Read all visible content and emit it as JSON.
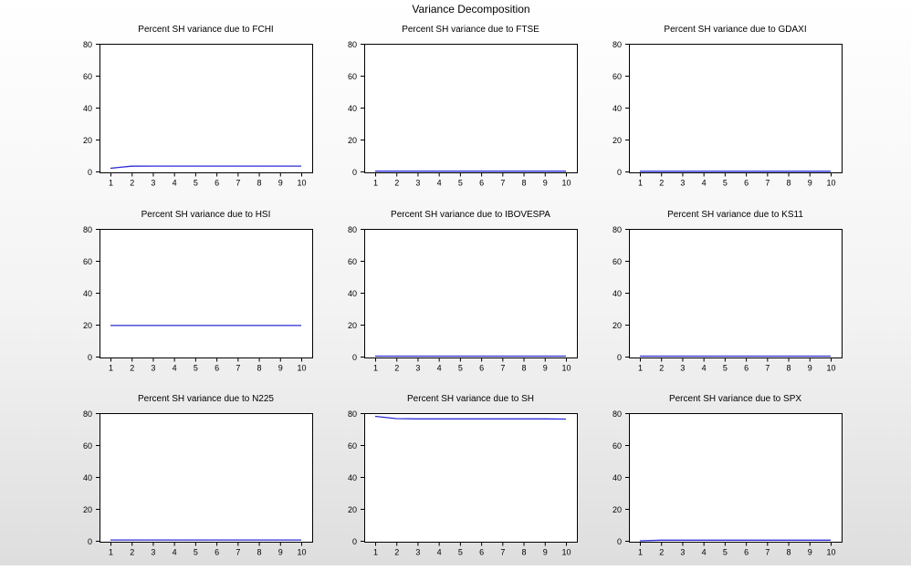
{
  "page": {
    "title": "Variance Decomposition"
  },
  "colors": {
    "line": "#2b2bd8",
    "axis": "#000000",
    "plot_bg": "#ffffff"
  },
  "chart_data": [
    {
      "type": "line",
      "title": "Percent SH variance due to FCHI",
      "x": [
        1,
        2,
        3,
        4,
        5,
        6,
        7,
        8,
        9,
        10
      ],
      "x_ticks": [
        "1",
        "2",
        "3",
        "4",
        "5",
        "6",
        "7",
        "8",
        "9",
        "10"
      ],
      "ylim": [
        0,
        80
      ],
      "y_ticks": [
        "0",
        "20",
        "40",
        "60",
        "80"
      ],
      "grid": false,
      "series": [
        {
          "values": [
            2.0,
            3.3,
            3.4,
            3.4,
            3.4,
            3.4,
            3.4,
            3.4,
            3.4,
            3.4
          ]
        }
      ]
    },
    {
      "type": "line",
      "title": "Percent SH variance due to FTSE",
      "x": [
        1,
        2,
        3,
        4,
        5,
        6,
        7,
        8,
        9,
        10
      ],
      "x_ticks": [
        "1",
        "2",
        "3",
        "4",
        "5",
        "6",
        "7",
        "8",
        "9",
        "10"
      ],
      "ylim": [
        0,
        80
      ],
      "y_ticks": [
        "0",
        "20",
        "40",
        "60",
        "80"
      ],
      "grid": false,
      "series": [
        {
          "values": [
            0.2,
            0.2,
            0.2,
            0.2,
            0.2,
            0.2,
            0.2,
            0.2,
            0.2,
            0.2
          ]
        }
      ]
    },
    {
      "type": "line",
      "title": "Percent SH variance due to GDAXI",
      "x": [
        1,
        2,
        3,
        4,
        5,
        6,
        7,
        8,
        9,
        10
      ],
      "x_ticks": [
        "1",
        "2",
        "3",
        "4",
        "5",
        "6",
        "7",
        "8",
        "9",
        "10"
      ],
      "ylim": [
        0,
        80
      ],
      "y_ticks": [
        "0",
        "20",
        "40",
        "60",
        "80"
      ],
      "grid": false,
      "series": [
        {
          "values": [
            0.1,
            0.1,
            0.1,
            0.1,
            0.1,
            0.1,
            0.1,
            0.1,
            0.1,
            0.1
          ]
        }
      ]
    },
    {
      "type": "line",
      "title": "Percent SH variance due to HSI",
      "x": [
        1,
        2,
        3,
        4,
        5,
        6,
        7,
        8,
        9,
        10
      ],
      "x_ticks": [
        "1",
        "2",
        "3",
        "4",
        "5",
        "6",
        "7",
        "8",
        "9",
        "10"
      ],
      "ylim": [
        0,
        80
      ],
      "y_ticks": [
        "0",
        "20",
        "40",
        "60",
        "80"
      ],
      "grid": false,
      "series": [
        {
          "values": [
            19.5,
            19.5,
            19.5,
            19.5,
            19.5,
            19.5,
            19.5,
            19.5,
            19.5,
            19.5
          ]
        }
      ]
    },
    {
      "type": "line",
      "title": "Percent SH variance due to IBOVESPA",
      "x": [
        1,
        2,
        3,
        4,
        5,
        6,
        7,
        8,
        9,
        10
      ],
      "x_ticks": [
        "1",
        "2",
        "3",
        "4",
        "5",
        "6",
        "7",
        "8",
        "9",
        "10"
      ],
      "ylim": [
        0,
        80
      ],
      "y_ticks": [
        "0",
        "20",
        "40",
        "60",
        "80"
      ],
      "grid": false,
      "series": [
        {
          "values": [
            0.3,
            0.3,
            0.3,
            0.3,
            0.3,
            0.3,
            0.3,
            0.3,
            0.3,
            0.3
          ]
        }
      ]
    },
    {
      "type": "line",
      "title": "Percent SH variance due to KS11",
      "x": [
        1,
        2,
        3,
        4,
        5,
        6,
        7,
        8,
        9,
        10
      ],
      "x_ticks": [
        "1",
        "2",
        "3",
        "4",
        "5",
        "6",
        "7",
        "8",
        "9",
        "10"
      ],
      "ylim": [
        0,
        80
      ],
      "y_ticks": [
        "0",
        "20",
        "40",
        "60",
        "80"
      ],
      "grid": false,
      "series": [
        {
          "values": [
            0.3,
            0.3,
            0.3,
            0.3,
            0.3,
            0.3,
            0.3,
            0.3,
            0.3,
            0.3
          ]
        }
      ]
    },
    {
      "type": "line",
      "title": "Percent SH variance due to N225",
      "x": [
        1,
        2,
        3,
        4,
        5,
        6,
        7,
        8,
        9,
        10
      ],
      "x_ticks": [
        "1",
        "2",
        "3",
        "4",
        "5",
        "6",
        "7",
        "8",
        "9",
        "10"
      ],
      "ylim": [
        0,
        80
      ],
      "y_ticks": [
        "0",
        "20",
        "40",
        "60",
        "80"
      ],
      "grid": false,
      "series": [
        {
          "values": [
            0.5,
            0.5,
            0.5,
            0.5,
            0.5,
            0.5,
            0.5,
            0.5,
            0.5,
            0.5
          ]
        }
      ]
    },
    {
      "type": "line",
      "title": "Percent SH variance due to SH",
      "x": [
        1,
        2,
        3,
        4,
        5,
        6,
        7,
        8,
        9,
        10
      ],
      "x_ticks": [
        "1",
        "2",
        "3",
        "4",
        "5",
        "6",
        "7",
        "8",
        "9",
        "10"
      ],
      "ylim": [
        0,
        80
      ],
      "y_ticks": [
        "0",
        "20",
        "40",
        "60",
        "80"
      ],
      "grid": false,
      "series": [
        {
          "values": [
            78.0,
            76.6,
            76.4,
            76.4,
            76.4,
            76.4,
            76.4,
            76.4,
            76.4,
            76.3
          ]
        }
      ]
    },
    {
      "type": "line",
      "title": "Percent SH variance due to SPX",
      "x": [
        1,
        2,
        3,
        4,
        5,
        6,
        7,
        8,
        9,
        10
      ],
      "x_ticks": [
        "1",
        "2",
        "3",
        "4",
        "5",
        "6",
        "7",
        "8",
        "9",
        "10"
      ],
      "ylim": [
        0,
        80
      ],
      "y_ticks": [
        "0",
        "20",
        "40",
        "60",
        "80"
      ],
      "grid": false,
      "series": [
        {
          "values": [
            0.0,
            0.4,
            0.4,
            0.4,
            0.4,
            0.4,
            0.4,
            0.4,
            0.4,
            0.4
          ]
        }
      ]
    }
  ]
}
